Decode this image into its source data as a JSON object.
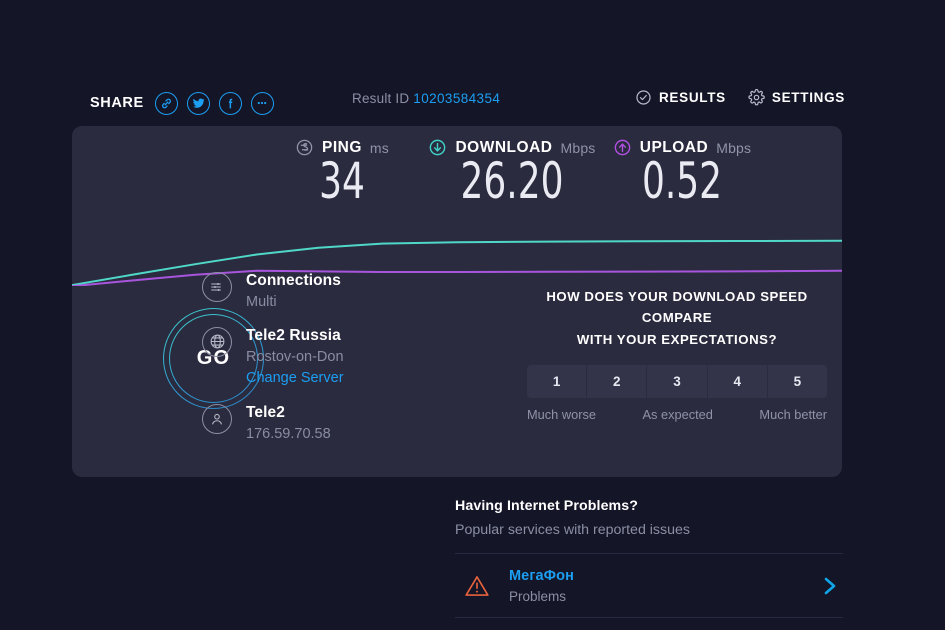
{
  "topbar": {
    "share_label": "SHARE",
    "share_icons": [
      {
        "name": "link-icon"
      },
      {
        "name": "twitter-icon"
      },
      {
        "name": "facebook-icon"
      },
      {
        "name": "more-icon"
      }
    ],
    "result_id_label": "Result ID",
    "result_id_value": "10203584354",
    "results_label": "RESULTS",
    "settings_label": "SETTINGS"
  },
  "metrics": {
    "ping": {
      "name": "PING",
      "unit": "ms",
      "value": "34",
      "icon": "ping-icon",
      "color": "#9296ab"
    },
    "download": {
      "name": "DOWNLOAD",
      "unit": "Mbps",
      "value": "26.20",
      "icon": "download-icon",
      "color": "#3fd2c7"
    },
    "upload": {
      "name": "UPLOAD",
      "unit": "Mbps",
      "value": "0.52",
      "icon": "upload-icon",
      "color": "#b04fe0"
    }
  },
  "chart_data": {
    "type": "line",
    "title": "",
    "xlabel": "",
    "ylabel": "",
    "grid": false,
    "legend": "none",
    "x": [
      0,
      0.08,
      0.16,
      0.24,
      0.32,
      0.4,
      0.5,
      0.62,
      0.74,
      0.86,
      1.0
    ],
    "ylim": [
      0,
      30
    ],
    "series": [
      {
        "name": "Download",
        "color": "#4fd8c8",
        "unit": "Mbps",
        "values": [
          1.6,
          7.5,
          13.2,
          18.6,
          22.4,
          24.6,
          25.4,
          25.8,
          26.0,
          26.1,
          26.2
        ]
      },
      {
        "name": "Upload",
        "color": "#a855dd",
        "unit": "Mbps",
        "values": [
          1.0,
          4.2,
          7.4,
          9.6,
          9.2,
          8.9,
          8.9,
          9.0,
          9.1,
          9.2,
          9.6
        ]
      }
    ]
  },
  "go": {
    "label": "GO"
  },
  "connection": {
    "rows": [
      {
        "icon": "connections-icon",
        "title": "Connections",
        "sub": "Multi",
        "link": ""
      },
      {
        "icon": "globe-icon",
        "title": "Tele2 Russia",
        "sub": "Rostov-on-Don",
        "link": "Change Server"
      },
      {
        "icon": "user-icon",
        "title": "Tele2",
        "sub": "176.59.70.58",
        "link": ""
      }
    ]
  },
  "survey": {
    "question_line1": "HOW DOES YOUR DOWNLOAD SPEED COMPARE",
    "question_line2": "WITH YOUR EXPECTATIONS?",
    "options": [
      "1",
      "2",
      "3",
      "4",
      "5"
    ],
    "label_low": "Much worse",
    "label_mid": "As expected",
    "label_high": "Much better"
  },
  "problems": {
    "title": "Having Internet Problems?",
    "subtitle": "Popular services with reported issues",
    "items": [
      {
        "name": "МегаФон",
        "status": "Problems",
        "icon": "warning-icon"
      }
    ]
  }
}
